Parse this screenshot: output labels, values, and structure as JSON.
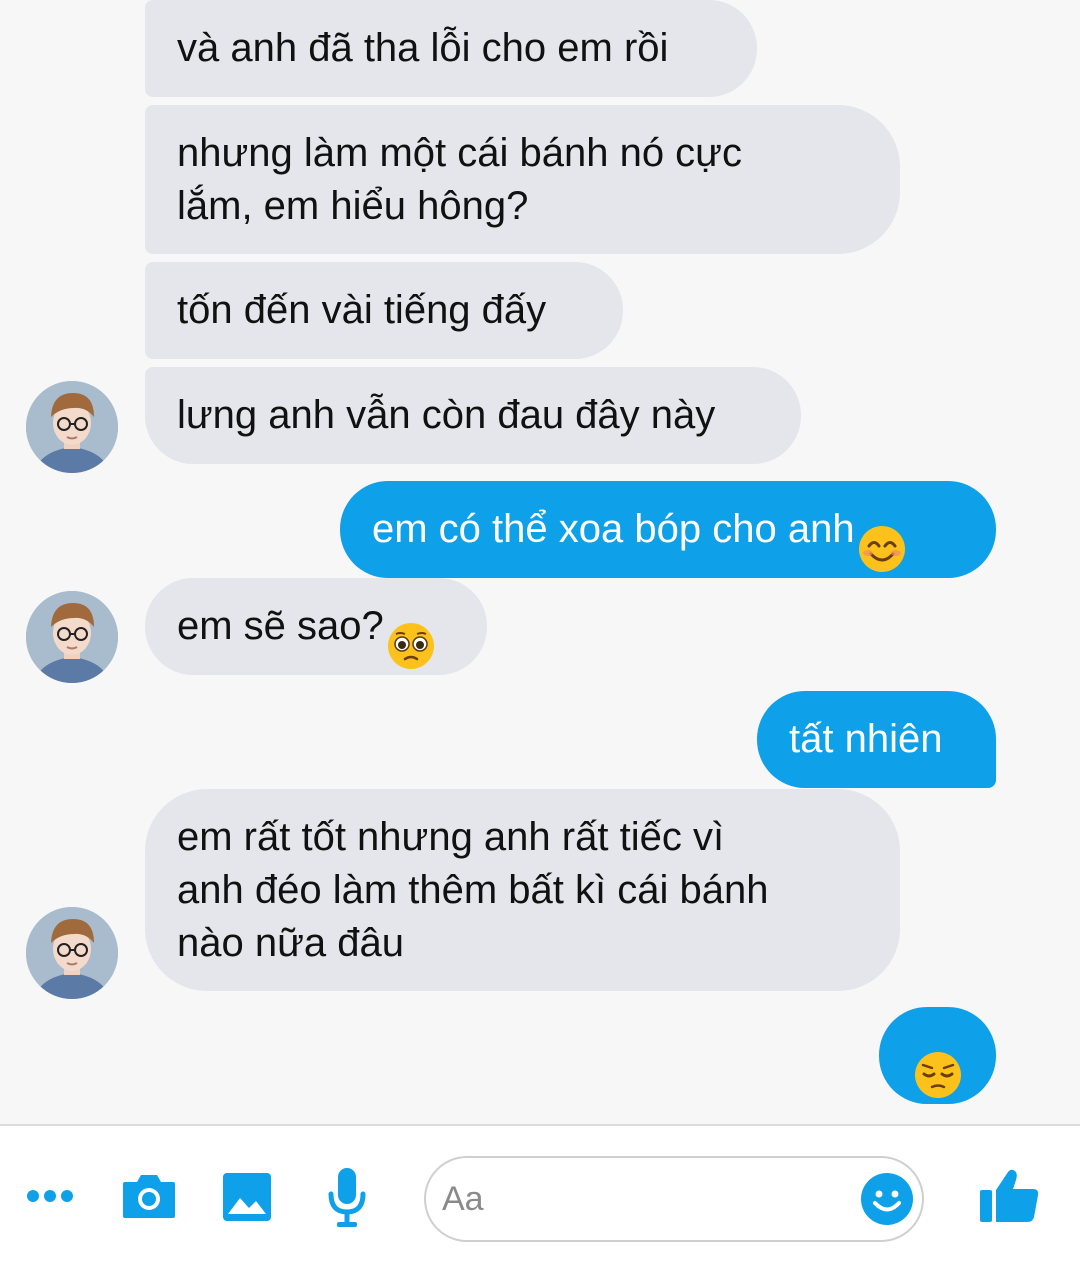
{
  "messages": [
    {
      "side": "received",
      "text": "và anh đã tha lỗi cho em rồi"
    },
    {
      "side": "received",
      "text": "nhưng làm một cái bánh nó cực\nlắm, em hiểu hông?"
    },
    {
      "side": "received",
      "text": "tốn đến vài tiếng đấy"
    },
    {
      "side": "received",
      "text": "lưng anh vẫn còn đau đây này"
    },
    {
      "side": "sent",
      "text": "em có thể xoa bóp cho anh",
      "emoji": "smiling-face-icon"
    },
    {
      "side": "received",
      "text": "em sẽ sao?",
      "emoji": "pleading-face-icon"
    },
    {
      "side": "sent",
      "text": "tất nhiên"
    },
    {
      "side": "received",
      "text": "em rất tốt nhưng anh rất tiếc vì\nanh đéo làm thêm bất kì cái bánh\nnào nữa đâu"
    },
    {
      "side": "sent",
      "text": "",
      "emoji": "pensive-face-icon"
    }
  ],
  "composer": {
    "placeholder": "Aa",
    "icons": [
      "more-icon",
      "camera-icon",
      "gallery-icon",
      "microphone-icon",
      "emoji-icon",
      "like-icon"
    ]
  },
  "colors": {
    "accent": "#0fa0ea",
    "received_bubble": "#e4e6eb",
    "background": "#f7f7f7"
  }
}
